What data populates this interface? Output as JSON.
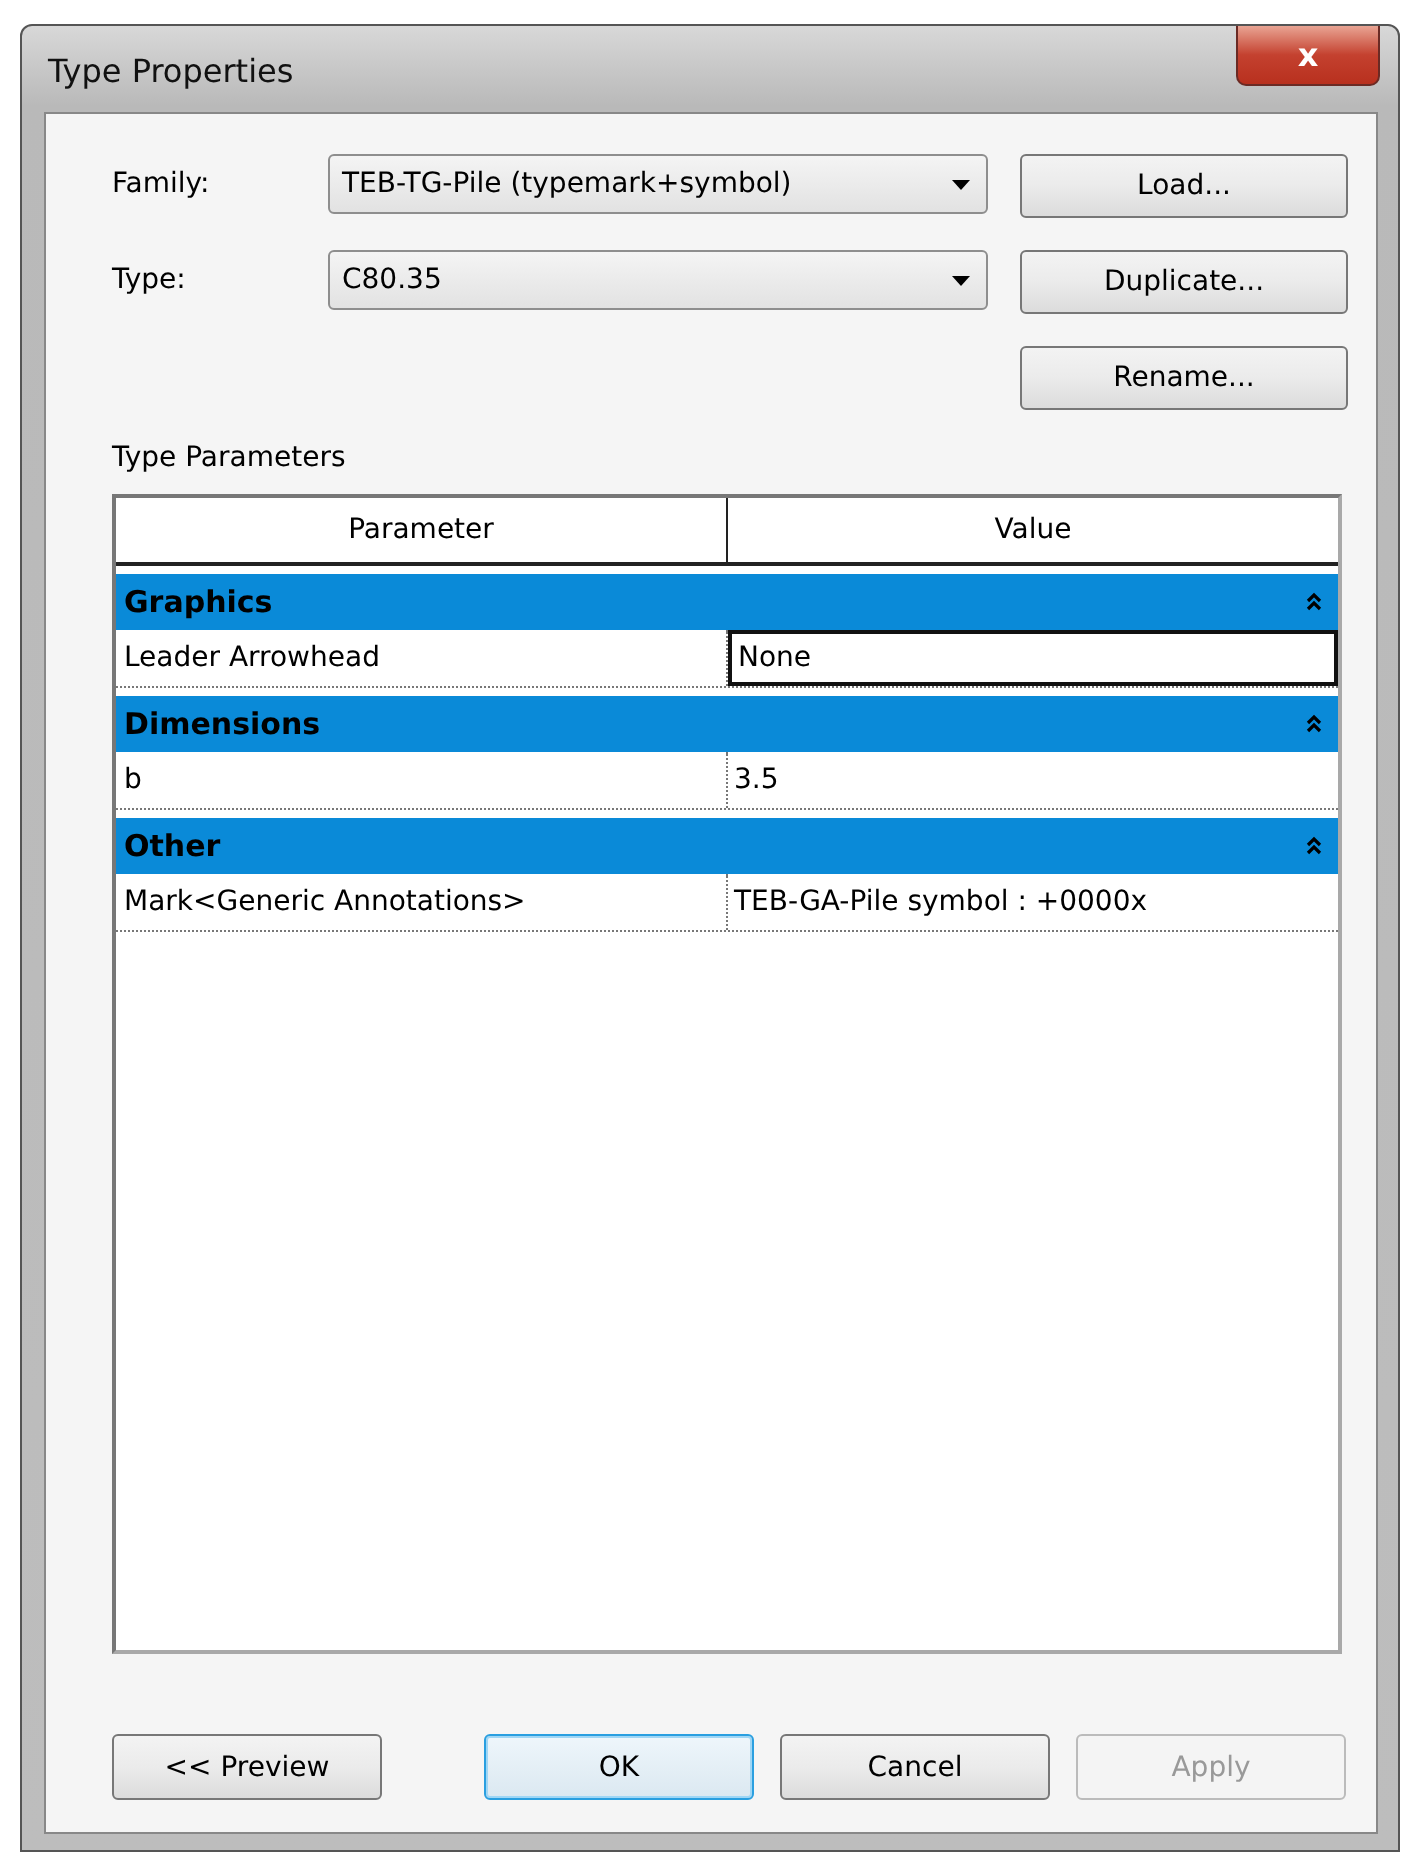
{
  "window": {
    "title": "Type Properties",
    "close_label": "x"
  },
  "fields": [
    {
      "label": "Family:",
      "value": "TEB-TG-Pile (typemark+symbol)"
    },
    {
      "label": "Type:",
      "value": "C80.35"
    }
  ],
  "side_buttons": [
    {
      "label": "Load...",
      "disabled": false
    },
    {
      "label": "Duplicate...",
      "disabled": false
    },
    {
      "label": "Rename...",
      "disabled": false
    }
  ],
  "table": {
    "title": "Type Parameters",
    "columns": [
      "Parameter",
      "Value"
    ],
    "groups": [
      {
        "name": "Graphics",
        "expanded": true,
        "rows": [
          {
            "parameter": "Leader Arrowhead",
            "value": "None",
            "selected": true
          }
        ]
      },
      {
        "name": "Dimensions",
        "expanded": true,
        "rows": [
          {
            "parameter": "b",
            "value": "3.5",
            "selected": false
          }
        ]
      },
      {
        "name": "Other",
        "expanded": true,
        "rows": [
          {
            "parameter": "Mark<Generic Annotations>",
            "value": "TEB-GA-Pile symbol : +0000x",
            "selected": false
          }
        ]
      }
    ]
  },
  "buttons": [
    {
      "label": "<< Preview",
      "default": false,
      "disabled": false
    },
    {
      "label": "OK",
      "default": true,
      "disabled": false
    },
    {
      "label": "Cancel",
      "default": false,
      "disabled": false
    },
    {
      "label": "Apply",
      "default": false,
      "disabled": true
    }
  ]
}
